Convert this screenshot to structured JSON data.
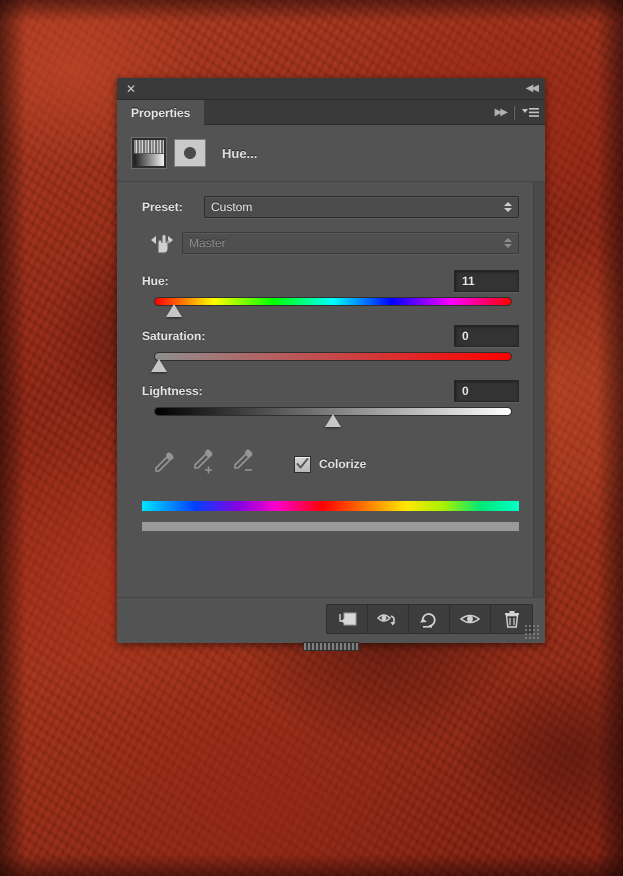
{
  "panel": {
    "titlebar": {
      "close_icon": "close-icon",
      "collapse_label": "◀◀"
    },
    "tab": {
      "label": "Properties",
      "expand_label": "▶▶",
      "menu_icon": "panel-menu-icon"
    },
    "header": {
      "adjustment_thumbnail": "hue-saturation-adjustment-thumbnail",
      "mask_thumbnail": "layer-mask-thumbnail",
      "title": "Hue..."
    },
    "preset": {
      "label": "Preset:",
      "value": "Custom"
    },
    "channel": {
      "scrubby_icon": "on-image-adjustment-hand-icon",
      "value": "Master",
      "disabled": true
    },
    "sliders": [
      {
        "name": "hue",
        "label": "Hue:",
        "value": "11",
        "min": -180,
        "max": 180,
        "thumb_percent": 5.5,
        "track": "hue-spectrum"
      },
      {
        "name": "saturation",
        "label": "Saturation:",
        "value": "0",
        "min": 0,
        "max": 100,
        "thumb_percent": 1.5,
        "track": "gray-to-red"
      },
      {
        "name": "lightness",
        "label": "Lightness:",
        "value": "0",
        "min": -100,
        "max": 100,
        "thumb_percent": 50,
        "track": "black-to-white"
      }
    ],
    "tools": {
      "eyedropper_sample": "eyedropper-icon",
      "eyedropper_add": "eyedropper-add-icon",
      "eyedropper_subtract": "eyedropper-subtract-icon",
      "colorize_label": "Colorize",
      "colorize_checked": true
    },
    "spectrum": {
      "hue_bar": "hue-spectrum-bar",
      "range_bar": "hue-range-bar"
    },
    "footer": {
      "buttons": [
        {
          "name": "clip-to-layer-button",
          "icon": "clip-to-layer-icon"
        },
        {
          "name": "view-previous-state-button",
          "icon": "eye-previous-state-icon"
        },
        {
          "name": "reset-adjustment-button",
          "icon": "reset-arrow-icon"
        },
        {
          "name": "toggle-visibility-button",
          "icon": "eye-icon"
        },
        {
          "name": "delete-adjustment-button",
          "icon": "trash-icon"
        }
      ],
      "resize_grip": "resize-grip",
      "bottom_grip": "panel-resize-handle"
    }
  },
  "colors": {
    "panel_bg": "#535353",
    "panel_chrome": "#3a3a3a",
    "input_bg": "#333333",
    "text": "#e4e4e4",
    "text_disabled": "#8d8d8d",
    "canvas_red": "#9e2b16"
  }
}
